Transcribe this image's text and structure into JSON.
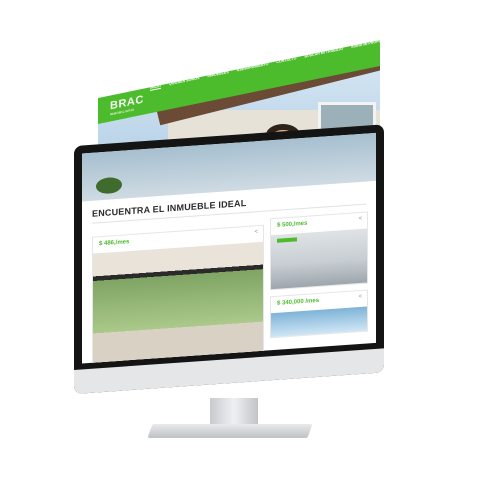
{
  "site": {
    "logo_text": "BRAC",
    "logo_subtext": "INMOBILIARIA",
    "nav": [
      "INICIO",
      "QUIENES SOMOS",
      "INMUEBLES",
      "ASESORAMIENTO",
      "CONTACTO",
      "BUSCAR MI TRABAJO",
      "SUBIR MI PROPIEDAD"
    ],
    "nav_active_index": 0
  },
  "listing": {
    "heading": "ENCUENTRA EL INMUEBLE IDEAL",
    "cards": [
      {
        "price": "$ 486,/mes"
      },
      {
        "price": "$ 500,/mes"
      },
      {
        "price": "$ 340,000 /mes"
      }
    ]
  },
  "icons": {
    "share": "share-icon"
  },
  "colors": {
    "brand_green": "#4cbb2c",
    "monitor_bezel": "#141414"
  }
}
